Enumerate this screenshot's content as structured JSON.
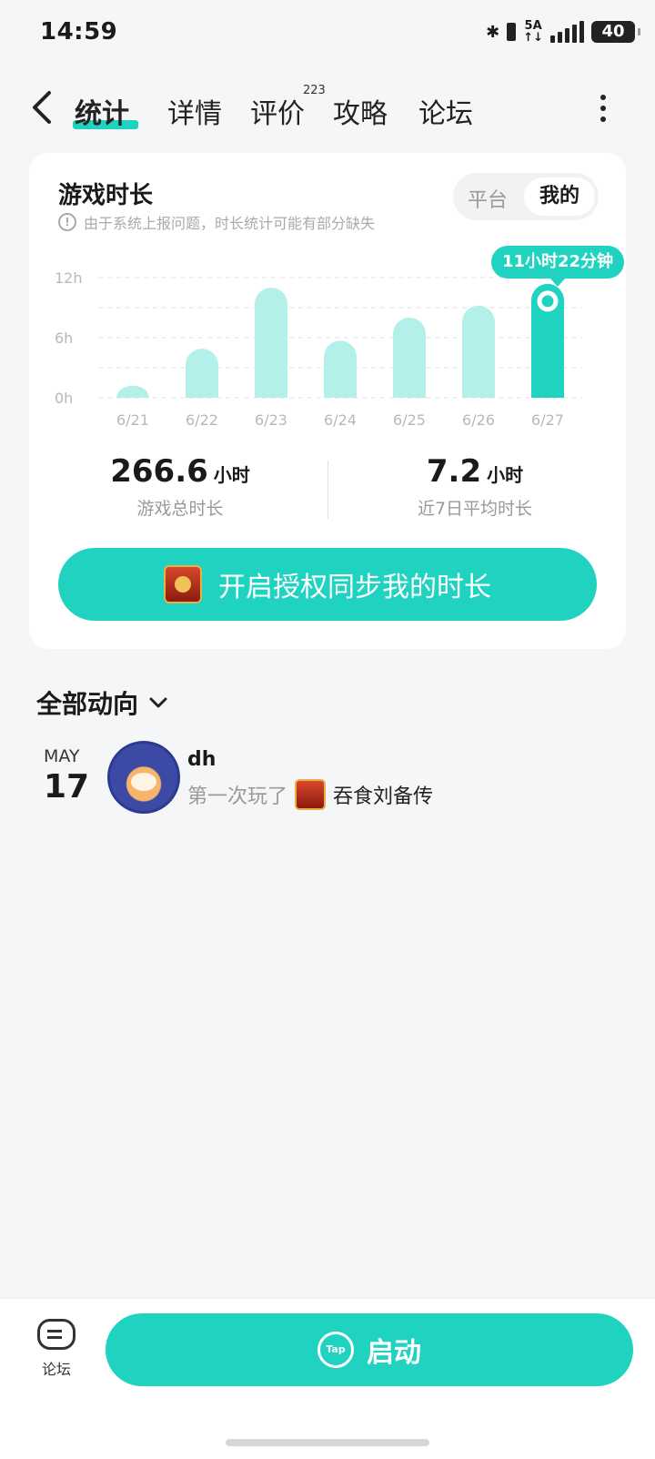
{
  "status": {
    "time": "14:59",
    "network": "5A",
    "battery": "40"
  },
  "nav": {
    "tabs": [
      {
        "label": "统计"
      },
      {
        "label": "详情"
      },
      {
        "label": "评价",
        "badge": "223"
      },
      {
        "label": "攻略"
      },
      {
        "label": "论坛"
      }
    ]
  },
  "card": {
    "title": "游戏时长",
    "notice": "由于系统上报问题，时长统计可能有部分缺失",
    "segment": [
      "平台",
      "我的"
    ],
    "tooltip": "11小时22分钟",
    "stats": [
      {
        "value": "266.6",
        "unit": "小时",
        "label": "游戏总时长"
      },
      {
        "value": "7.2",
        "unit": "小时",
        "label": "近7日平均时长"
      }
    ],
    "sync_button": "开启授权同步我的时长"
  },
  "chart_data": {
    "type": "bar",
    "categories": [
      "6/21",
      "6/22",
      "6/23",
      "6/24",
      "6/25",
      "6/26",
      "6/27"
    ],
    "values": [
      1.2,
      4.9,
      11.0,
      5.7,
      8.0,
      9.2,
      11.37
    ],
    "y_ticks": [
      "12h",
      "6h",
      "0h"
    ],
    "ylim": [
      0,
      12
    ],
    "grid": true,
    "colors": {
      "normal": "#b3f0ea",
      "selected": "#1fd3c0"
    },
    "selected_index": 6
  },
  "feed": {
    "title": "全部动向",
    "items": [
      {
        "month": "MAY",
        "day": "17",
        "user": "dh",
        "action": "第一次玩了",
        "game": "吞食刘备传"
      }
    ]
  },
  "bottom": {
    "forum_label": "论坛",
    "launch_label": "启动",
    "tap_text": "Tap"
  }
}
